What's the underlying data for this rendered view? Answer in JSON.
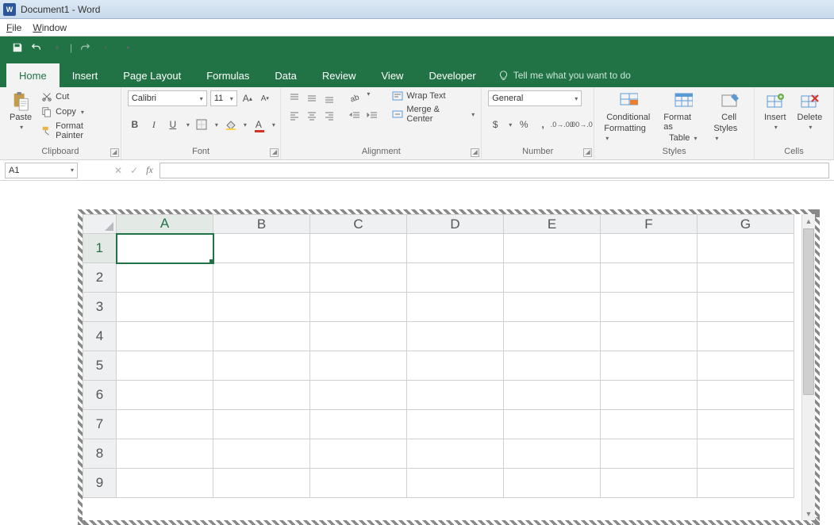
{
  "titlebar": {
    "app_icon_text": "W",
    "title": "Document1 - Word"
  },
  "menubar": {
    "file": "File",
    "window": "Window"
  },
  "tabs": [
    "Home",
    "Insert",
    "Page Layout",
    "Formulas",
    "Data",
    "Review",
    "View",
    "Developer"
  ],
  "tellme": "Tell me what you want to do",
  "ribbon": {
    "clipboard": {
      "paste": "Paste",
      "cut": "Cut",
      "copy": "Copy",
      "format_painter": "Format Painter",
      "label": "Clipboard"
    },
    "font": {
      "name": "Calibri",
      "size": "11",
      "label": "Font",
      "bold": "B",
      "italic": "I",
      "underline": "U"
    },
    "alignment": {
      "label": "Alignment",
      "wrap": "Wrap Text",
      "merge": "Merge & Center"
    },
    "number": {
      "label": "Number",
      "format": "General",
      "currency": "$",
      "percent": "%",
      "comma": ","
    },
    "styles": {
      "label": "Styles",
      "cond": "Conditional",
      "cond2": "Formatting",
      "fmt_table": "Format as",
      "fmt_table2": "Table",
      "cell_styles": "Cell",
      "cell_styles2": "Styles"
    },
    "cells": {
      "label": "Cells",
      "insert": "Insert",
      "delete": "Delete"
    }
  },
  "fxbar": {
    "namebox": "A1",
    "fx": "fx"
  },
  "sheet": {
    "columns": [
      "A",
      "B",
      "C",
      "D",
      "E",
      "F",
      "G"
    ],
    "rows": [
      "1",
      "2",
      "3",
      "4",
      "5",
      "6",
      "7",
      "8",
      "9"
    ],
    "selected": {
      "col": "A",
      "row": "1"
    }
  }
}
